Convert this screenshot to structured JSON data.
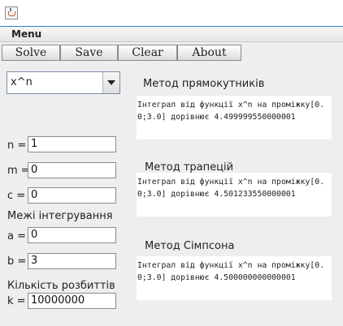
{
  "menubar": {
    "menu_label": "Menu"
  },
  "toolbar": {
    "solve_label": "Solve",
    "save_label": "Save",
    "clear_label": "Clear",
    "about_label": "About"
  },
  "function_select": {
    "selected": "x^n"
  },
  "params": {
    "n_label": "n =",
    "n_value": "1",
    "m_label": "m =",
    "m_value": "0",
    "c_label": "c =",
    "c_value": "0"
  },
  "bounds": {
    "heading": "Межі інтегрування",
    "a_label": "a =",
    "a_value": "0",
    "b_label": "b =",
    "b_value": "3"
  },
  "partitions": {
    "heading": "Кількість розбиттів",
    "k_label": "k =",
    "k_value": "10000000"
  },
  "results": {
    "rect_title": "Метод прямокутників",
    "rect_text": "Інтеграл від функції x^n на проміжку[0.0;3.0] дорівнює 4.499999550000001",
    "trap_title": "Метод трапецій",
    "trap_text": "Інтеграл від функції x^n на проміжку[0.0;3.0] дорівнює 4.501233550000001",
    "simpson_title": "Метод Сімпсона",
    "simpson_text": "Інтеграл від функції x^n на проміжку[0.0;3.0] дорівнює 4.500000000000001"
  }
}
